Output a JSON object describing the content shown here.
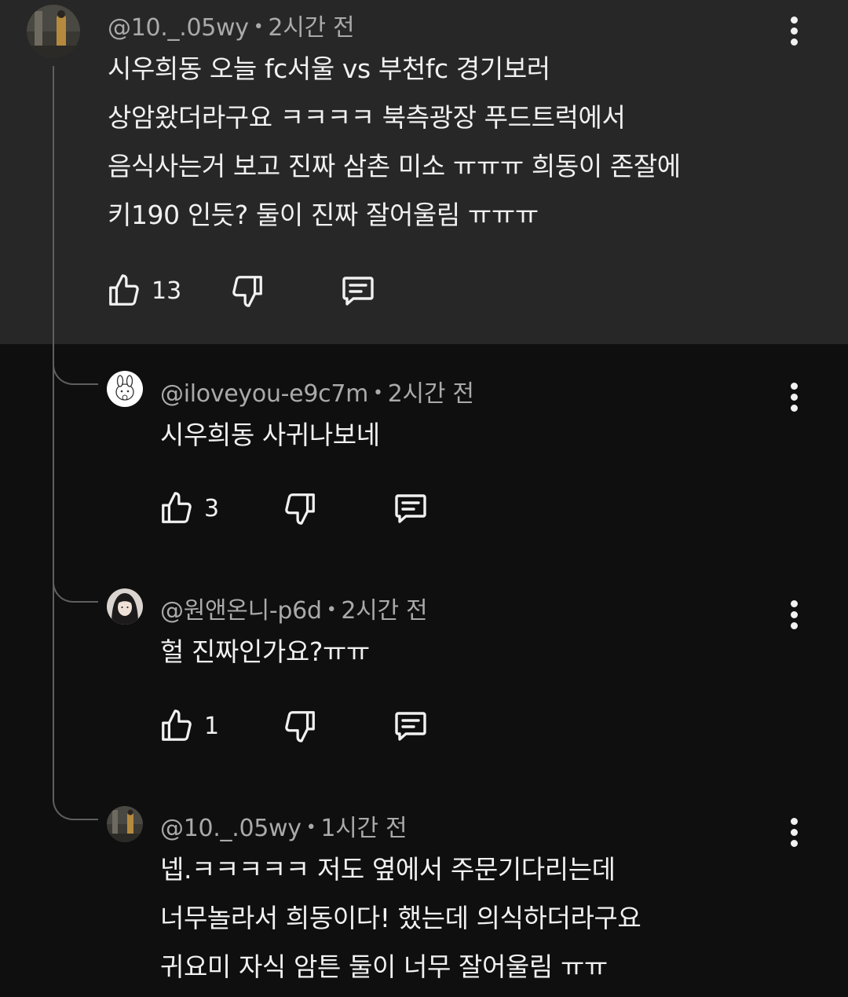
{
  "comments": [
    {
      "handle": "@10._.05wy",
      "time": "2시간 전",
      "lines": [
        "시우희동 오늘 fc서울 vs 부천fc 경기보러",
        "상암왔더라구요 ㅋㅋㅋㅋ 북측광장 푸드트럭에서",
        "음식사는거 보고 진짜 삼촌 미소 ㅠㅠㅠ 희동이 존잘에",
        "키190 인듯?  둘이 진짜 잘어울림 ㅠㅠㅠ"
      ],
      "likes": "13"
    },
    {
      "handle": "@iloveyou-e9c7m",
      "time": "2시간 전",
      "lines": [
        "시우희동 사귀나보네"
      ],
      "likes": "3"
    },
    {
      "handle": "@원앤온니-p6d",
      "time": "2시간 전",
      "lines": [
        "헐 진짜인가요?ㅠㅠ"
      ],
      "likes": "1"
    },
    {
      "handle": "@10._.05wy",
      "time": "1시간 전",
      "lines": [
        "넵.ㅋㅋㅋㅋㅋ 저도 옆에서 주문기다리는데",
        "너무놀라서 희동이다! 했는데 의식하더라구요",
        "귀요미 자식 암튼 둘이 너무 잘어울림 ㅠㅠ"
      ],
      "likes": ""
    }
  ],
  "separator": "•",
  "colors": {
    "top_comment_bg": "#272727",
    "page_bg": "#0f0f0f",
    "thread_line": "#5f5f5f",
    "meta_text": "#aaaaaa",
    "body_text": "#f1f1f1"
  },
  "icons": {
    "like": "thumb-up-icon",
    "dislike": "thumb-down-icon",
    "reply": "reply-comment-icon",
    "more": "more-vertical-icon"
  }
}
